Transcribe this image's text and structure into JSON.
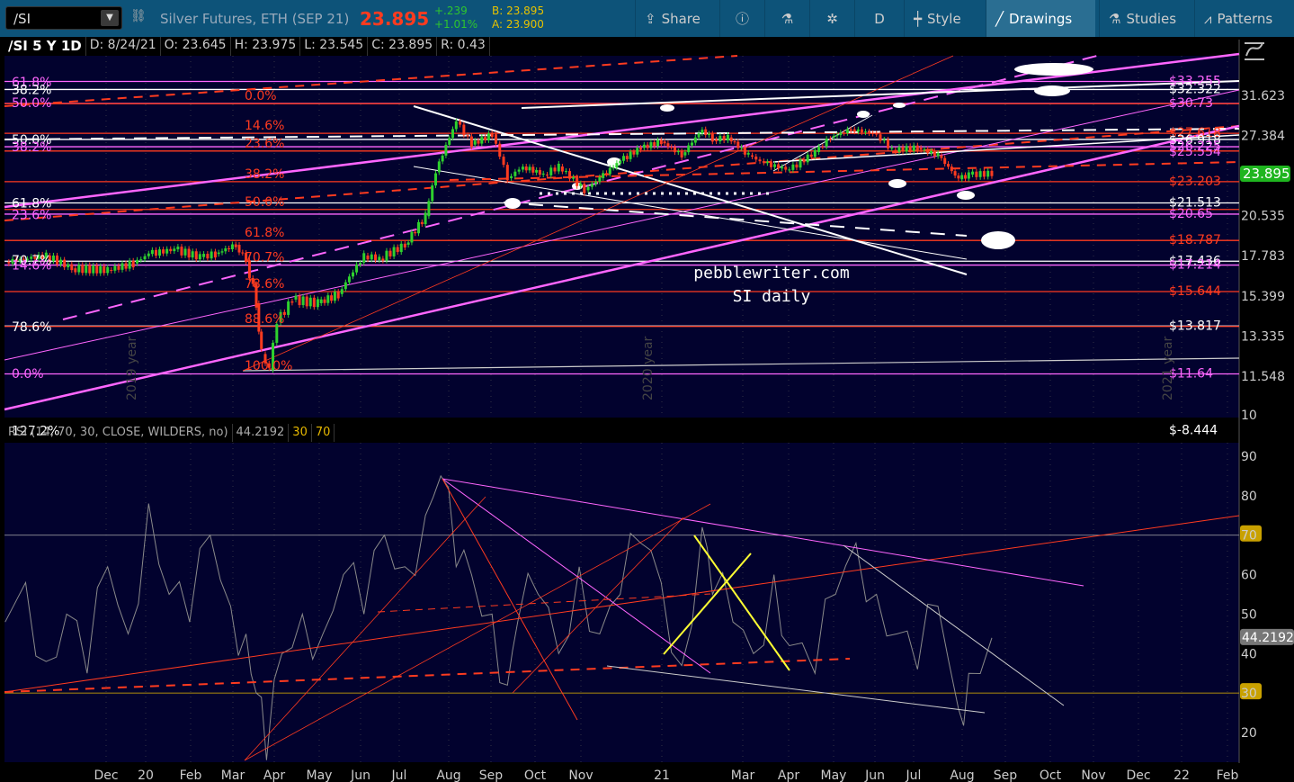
{
  "toolbar": {
    "symbol": "/SI",
    "description": "Silver Futures, ETH (SEP 21)",
    "last": "23.895",
    "change": "+.239",
    "change_pct": "+1.01%",
    "bid": "B: 23.895",
    "ask": "A: 23.900",
    "buttons": [
      {
        "label": "Share",
        "icon": "share-icon"
      },
      {
        "label": "",
        "icon": "info-icon"
      },
      {
        "label": "",
        "icon": "flask-icon"
      },
      {
        "label": "",
        "icon": "gear-icon"
      },
      {
        "label": "D",
        "icon": ""
      },
      {
        "label": "Style",
        "icon": "candle-icon"
      },
      {
        "label": "Drawings",
        "icon": "pencil-line-icon"
      },
      {
        "label": "Studies",
        "icon": "flask-icon"
      },
      {
        "label": "Patterns",
        "icon": "patterns-icon"
      }
    ]
  },
  "header": {
    "title": "/SI 5 Y 1D",
    "date": "D: 8/24/21",
    "open": "O: 23.645",
    "high": "H: 23.975",
    "low": "L: 23.545",
    "close": "C: 23.895",
    "range": "R: 0.43"
  },
  "rsi_header": {
    "label": "RSI (14, 70, 30, CLOSE, WILDERS, no)",
    "value": "44.2192",
    "low": "30",
    "high": "70"
  },
  "watermark": {
    "line1": "pebblewriter.com",
    "line2": "SI daily"
  },
  "year_labels": [
    "2019 year",
    "2020 year",
    "2021 year"
  ],
  "fib_left": [
    {
      "t": "61.8%",
      "c": "#ff66ff",
      "p": 33.2
    },
    {
      "t": "38.2%",
      "c": "#ffffff",
      "p": 32.3
    },
    {
      "t": "50.0%",
      "c": "#ff66ff",
      "p": 30.8
    },
    {
      "t": "50.0%",
      "c": "#ffffff",
      "p": 27.0
    },
    {
      "t": "38.2%",
      "c": "#ff66ff",
      "p": 26.3
    },
    {
      "t": "61.8%",
      "c": "#ffffff",
      "p": 21.5
    },
    {
      "t": "23.6%",
      "c": "#ff66ff",
      "p": 20.6
    },
    {
      "t": "70.7%",
      "c": "#ffffff",
      "p": 17.5
    },
    {
      "t": "14.6%",
      "c": "#ff66ff",
      "p": 17.2
    },
    {
      "t": "78.6%",
      "c": "#ffffff",
      "p": 13.8
    },
    {
      "t": "0.0%",
      "c": "#ff66ff",
      "p": 11.65
    },
    {
      "t": "127.2%",
      "c": "#ffffff",
      "p": 9.5
    }
  ],
  "fib_mid": [
    {
      "t": "0.0%",
      "p": 30.7
    },
    {
      "t": "14.6%",
      "p": 27.6
    },
    {
      "t": "23.6%",
      "p": 25.9
    },
    {
      "t": "38.2%",
      "p": 23.2
    },
    {
      "t": "50.0%",
      "p": 21.0
    },
    {
      "t": "61.8%",
      "p": 18.8
    },
    {
      "t": "70.7%",
      "p": 17.2
    },
    {
      "t": "78.6%",
      "p": 15.65
    },
    {
      "t": "88.6%",
      "p": 13.8
    },
    {
      "t": "100.0%",
      "p": 11.65
    }
  ],
  "price_labels": [
    {
      "t": "$33.255",
      "c": "#ff66ff",
      "p": 33.25
    },
    {
      "t": "$32.322",
      "c": "#ffffff",
      "p": 32.3
    },
    {
      "t": "$30.73",
      "c": "#ff66ff",
      "p": 30.73
    },
    {
      "t": "$27.618",
      "c": "#ff3b1f",
      "p": 27.6
    },
    {
      "t": "$26.918",
      "c": "#ffffff",
      "p": 26.9
    },
    {
      "t": "$26.225",
      "c": "#ff66ff",
      "p": 26.3
    },
    {
      "t": "$25.554",
      "c": "#ff66ff",
      "p": 25.8
    },
    {
      "t": "$23.203",
      "c": "#ff3b1f",
      "p": 23.2
    },
    {
      "t": "$21.513",
      "c": "#ffffff",
      "p": 21.5
    },
    {
      "t": "$20.65",
      "c": "#ff66ff",
      "p": 20.65
    },
    {
      "t": "$18.787",
      "c": "#ff3b1f",
      "p": 18.79
    },
    {
      "t": "$17.436",
      "c": "#ffffff",
      "p": 17.44
    },
    {
      "t": "$17.214",
      "c": "#ff66ff",
      "p": 17.2
    },
    {
      "t": "$15.644",
      "c": "#ff3b1f",
      "p": 15.64
    },
    {
      "t": "$13.817",
      "c": "#ffffff",
      "p": 13.82
    },
    {
      "t": "$11.64",
      "c": "#ff66ff",
      "p": 11.64
    },
    {
      "t": "$-8.444",
      "c": "#ffffff",
      "p": 9.5
    }
  ],
  "chart_data": [
    {
      "type": "line",
      "title": "/SI 5 Y 1D",
      "y_scale": "log",
      "yticks": [
        "31.623",
        "27.384",
        "23.895",
        "20.535",
        "17.783",
        "15.399",
        "13.335",
        "11.548",
        "10"
      ],
      "current": "23.895",
      "x": [
        2019.72,
        2019.8,
        2019.85,
        2019.92,
        2019.97,
        2020.0,
        2020.05,
        2020.1,
        2020.13,
        2020.17,
        2020.19,
        2020.21,
        2020.22,
        2020.235,
        2020.25,
        2020.28,
        2020.33,
        2020.37,
        2020.42,
        2020.45,
        2020.5,
        2020.54,
        2020.56,
        2020.6,
        2020.63,
        2020.67,
        2020.7,
        2020.73,
        2020.77,
        2020.8,
        2020.85,
        2020.88,
        2020.92,
        2020.96,
        2021.0,
        2021.04,
        2021.08,
        2021.1,
        2021.13,
        2021.17,
        2021.2,
        2021.25,
        2021.3,
        2021.33,
        2021.37,
        2021.42,
        2021.45,
        2021.5,
        2021.54,
        2021.58,
        2021.6,
        2021.645
      ],
      "values": [
        17.4,
        17.8,
        17.0,
        16.9,
        17.3,
        17.9,
        18.2,
        17.7,
        17.9,
        18.5,
        17.5,
        15.0,
        12.5,
        11.8,
        14.0,
        15.2,
        15.0,
        15.5,
        17.8,
        17.6,
        18.5,
        20.5,
        24.0,
        28.8,
        26.5,
        27.5,
        23.5,
        24.5,
        23.8,
        24.5,
        22.5,
        23.5,
        25.0,
        26.2,
        26.8,
        25.5,
        28.0,
        27.0,
        27.2,
        25.5,
        24.8,
        24.2,
        25.8,
        27.2,
        28.0,
        27.5,
        26.0,
        26.2,
        25.5,
        23.4,
        23.8,
        23.9
      ]
    },
    {
      "type": "line",
      "title": "RSI (14, 70, 30, CLOSE, WILDERS, no)",
      "ylim": [
        10,
        95
      ],
      "yticks": [
        "90",
        "80",
        "70",
        "60",
        "50",
        "40",
        "30",
        "20"
      ],
      "current": "44.2192",
      "x": [
        2019.72,
        2019.76,
        2019.8,
        2019.84,
        2019.88,
        2019.92,
        2019.96,
        2020.0,
        2020.04,
        2020.08,
        2020.12,
        2020.16,
        2020.19,
        2020.21,
        2020.23,
        2020.26,
        2020.3,
        2020.34,
        2020.38,
        2020.42,
        2020.46,
        2020.5,
        2020.54,
        2020.57,
        2020.6,
        2020.63,
        2020.67,
        2020.7,
        2020.72,
        2020.76,
        2020.8,
        2020.84,
        2020.88,
        2020.92,
        2020.96,
        2021.0,
        2021.04,
        2021.08,
        2021.1,
        2021.14,
        2021.18,
        2021.22,
        2021.25,
        2021.3,
        2021.34,
        2021.38,
        2021.42,
        2021.46,
        2021.5,
        2021.54,
        2021.58,
        2021.6,
        2021.645
      ],
      "values": [
        48,
        58,
        38,
        50,
        35,
        62,
        45,
        78,
        55,
        48,
        70,
        52,
        45,
        30,
        13,
        40,
        50,
        45,
        60,
        50,
        70,
        62,
        75,
        85,
        62,
        60,
        50,
        32,
        48,
        55,
        40,
        62,
        45,
        55,
        68,
        58,
        37,
        72,
        55,
        48,
        40,
        60,
        42,
        35,
        55,
        68,
        55,
        45,
        36,
        52,
        26,
        35,
        44
      ]
    }
  ],
  "time_axis": [
    "Dec",
    "20",
    "Feb",
    "Mar",
    "Apr",
    "May",
    "Jun",
    "Jul",
    "Aug",
    "Sep",
    "Oct",
    "Nov",
    "21",
    "Mar",
    "Apr",
    "May",
    "Jun",
    "Jul",
    "Aug",
    "Sep",
    "Oct",
    "Nov",
    "Dec",
    "22",
    "Feb"
  ]
}
